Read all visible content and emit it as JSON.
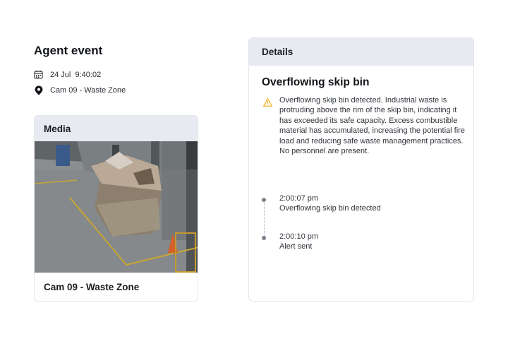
{
  "event": {
    "title": "Agent event",
    "date": "24 Jul",
    "time": "9:40:02",
    "camera": "Cam 09 - Waste Zone"
  },
  "media": {
    "header": "Media",
    "caption": "Cam 09 - Waste Zone"
  },
  "details": {
    "header": "Details",
    "title": "Overflowing skip bin",
    "description": "Overflowing skip bin detected. Industrial waste is protruding above the rim of the skip bin, indicating it has exceeded its safe capacity. Excess combustible material has accumulated, increasing the potential fire load and reducing safe waste management practices. No personnel are present.",
    "timeline": [
      {
        "time": "2:00:07 pm",
        "text": "Overflowing skip bin detected"
      },
      {
        "time": "2:00:10 pm",
        "text": "Alert sent"
      }
    ]
  },
  "icons": {
    "date": "calendar-icon",
    "camera": "location-pin-icon",
    "warning": "warning-triangle-icon"
  },
  "colors": {
    "header_bg": "#e7eaf1",
    "warning": "#f2b01e",
    "timeline_dot": "#7d8591"
  }
}
